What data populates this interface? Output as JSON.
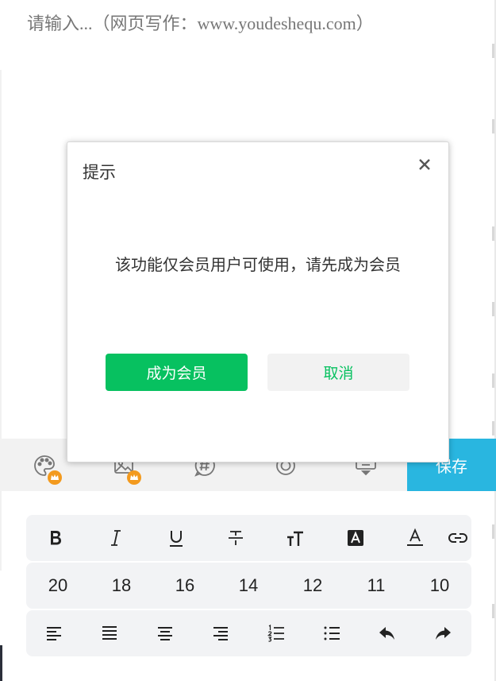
{
  "editor": {
    "placeholder": "请输入...（网页写作：www.youdeshequ.com）"
  },
  "toolbar": {
    "items": [
      {
        "icon": "palette-icon",
        "vip": true
      },
      {
        "icon": "image-icon",
        "vip": true
      },
      {
        "icon": "topic-hash-icon",
        "vip": false
      },
      {
        "icon": "location-icon",
        "vip": false
      },
      {
        "icon": "keyboard-hide-icon",
        "vip": false
      }
    ],
    "save_label": "保存",
    "save_color": "#29b6e0"
  },
  "format_panel": {
    "style_buttons": [
      "bold-icon",
      "italic-icon",
      "underline-icon",
      "strikethrough-icon",
      "font-size-icon",
      "highlight-icon",
      "font-color-icon",
      "link-icon"
    ],
    "font_sizes": [
      "20",
      "18",
      "16",
      "14",
      "12",
      "11",
      "10"
    ],
    "align_buttons": [
      "align-left-icon",
      "align-justify-icon",
      "align-center-icon",
      "align-right-icon",
      "ordered-list-icon",
      "bullet-list-icon",
      "undo-icon",
      "redo-icon"
    ]
  },
  "dialog": {
    "title": "提示",
    "message": "该功能仅会员用户可使用，请先成为会员",
    "primary_label": "成为会员",
    "secondary_label": "取消",
    "primary_color": "#07c160"
  }
}
